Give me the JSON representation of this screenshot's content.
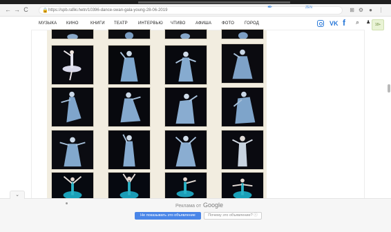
{
  "browser": {
    "url": "https://spb.rafiki.hetn/10396-dance-swan-gala-young-28-06-2019",
    "back": "←",
    "forward": "→",
    "reload": "C",
    "lock": "🔒"
  },
  "nav": {
    "items": [
      "МУЗЫКА",
      "КИНО",
      "КНИГИ",
      "ТЕАТР",
      "ИНТЕРВЬЮ",
      "ЧТИВО",
      "АФИША",
      "ФОТО",
      "ГОРОД"
    ],
    "zen": "ZEN",
    "vk": "VK",
    "facebook": "f",
    "search_icon": "⌕",
    "user_icon": "♟",
    "menu_icon": "≡"
  },
  "side_badge": "18+",
  "ad": {
    "label": "Реклама от",
    "google": "Google",
    "hide_button": "Не показывать это объявление",
    "why_button": "Почему это объявление? ⓘ"
  },
  "collapse_icon": "⌄",
  "colors": {
    "accent": "#2878d8",
    "ad_button": "#4a86e8",
    "photo_bg": "#f2ede0"
  }
}
